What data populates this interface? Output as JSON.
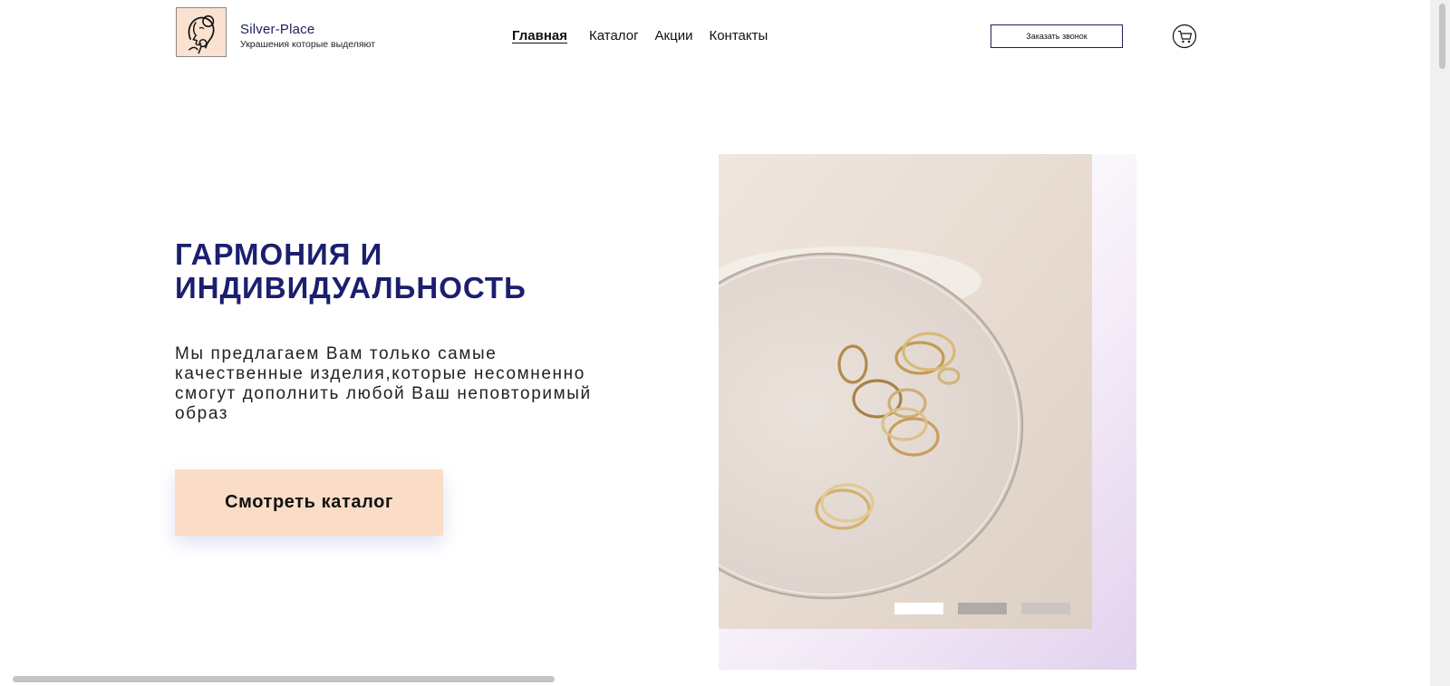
{
  "header": {
    "brand_name": "Silver-Place",
    "tagline": "Украшения которые выделяют",
    "nav": [
      {
        "label": "Главная",
        "active": true
      },
      {
        "label": "Каталог",
        "active": false
      },
      {
        "label": "Акции",
        "active": false
      },
      {
        "label": "Контакты",
        "active": false
      }
    ],
    "call_button": "Заказать звонок",
    "cart_icon": "cart-icon"
  },
  "hero": {
    "title_line1": "ГАРМОНИЯ И",
    "title_line2": "ИНДИВИДУАЛЬНОСТЬ",
    "text": "Мы предлагаем Вам только самые качественные изделия,которые несомненно смогут дополнить любой Ваш неповторимый образ",
    "cta": "Смотреть каталог",
    "slides": 3,
    "active_slide": 1
  },
  "colors": {
    "accent_navy": "#1b1f6e",
    "cta_background": "#fbdcc6",
    "logo_background": "#fbe1cf"
  }
}
